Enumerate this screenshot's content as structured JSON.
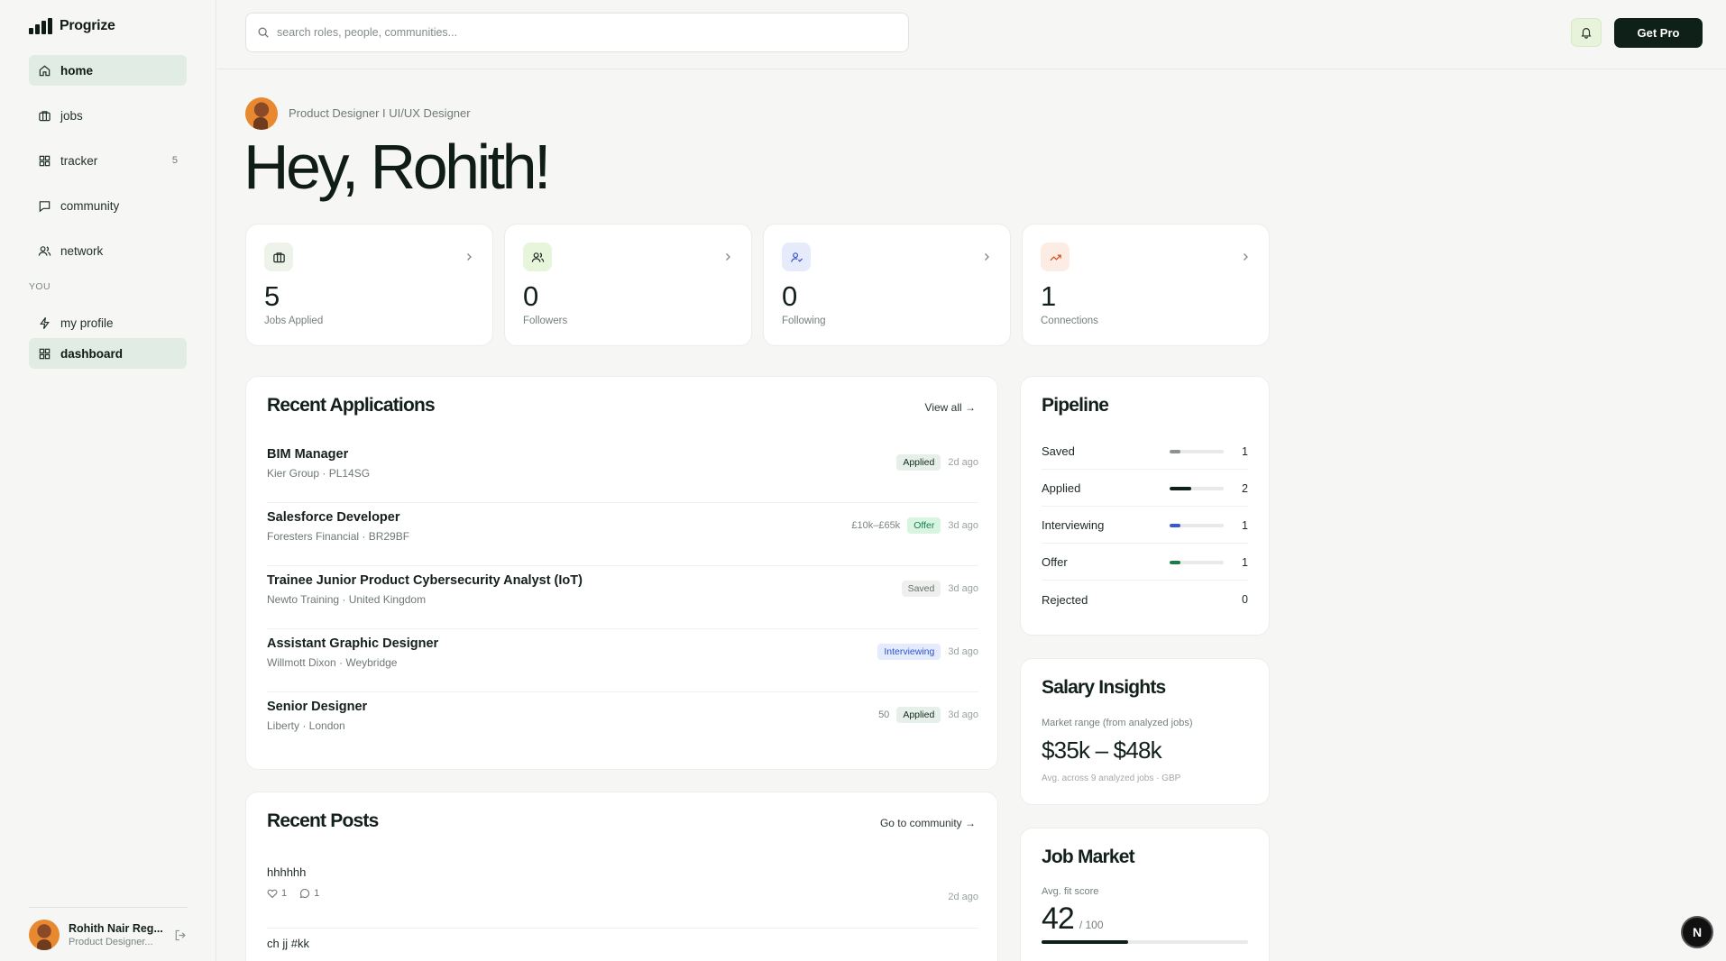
{
  "brand": {
    "name": "Progrize"
  },
  "sidebar": {
    "items": [
      {
        "label": "home",
        "icon": "home-icon",
        "active": true
      },
      {
        "label": "jobs",
        "icon": "briefcase-icon"
      },
      {
        "label": "tracker",
        "icon": "grid-icon",
        "count": "5"
      },
      {
        "label": "community",
        "icon": "chat-icon"
      },
      {
        "label": "network",
        "icon": "users-icon"
      }
    ],
    "section_label": "YOU",
    "you_items": [
      {
        "label": "my profile",
        "icon": "bolt-icon"
      },
      {
        "label": "dashboard",
        "icon": "grid-icon",
        "active": true
      }
    ],
    "user": {
      "name": "Rohith Nair Reg...",
      "role": "Product Designer..."
    }
  },
  "search": {
    "placeholder": "search roles, people, communities..."
  },
  "topbar": {
    "get_pro_label": "Get Pro"
  },
  "hero": {
    "subtitle": "Product Designer I UI/UX Designer",
    "greeting": "Hey, Rohith!"
  },
  "stats": [
    {
      "value": "5",
      "label": "Jobs Applied",
      "icon": "briefcase-icon",
      "color": "#eef3ea"
    },
    {
      "value": "0",
      "label": "Followers",
      "icon": "users-icon",
      "color": "#e7f5db"
    },
    {
      "value": "0",
      "label": "Following",
      "icon": "user-check-icon",
      "color": "#e6ebfb"
    },
    {
      "value": "1",
      "label": "Connections",
      "icon": "trending-up-icon",
      "color": "#fdece4"
    }
  ],
  "recent_applications": {
    "title": "Recent Applications",
    "link": "View all →",
    "rows": [
      {
        "title": "BIM Manager",
        "sub": "Kier Group · PL14SG",
        "meta": "",
        "status": "Applied",
        "age": "2d ago"
      },
      {
        "title": "Salesforce Developer",
        "sub": "Foresters Financial · BR29BF",
        "meta": "£10k–£65k",
        "status": "Offer",
        "age": "3d ago"
      },
      {
        "title": "Trainee Junior Product Cybersecurity Analyst (IoT)",
        "sub": "Newto Training · United Kingdom",
        "meta": "",
        "status": "Saved",
        "age": "3d ago"
      },
      {
        "title": "Assistant Graphic Designer",
        "sub": "Willmott Dixon · Weybridge",
        "meta": "",
        "status": "Interviewing",
        "age": "3d ago"
      },
      {
        "title": "Senior Designer",
        "sub": "Liberty · London",
        "meta": "50",
        "status": "Applied",
        "age": "3d ago"
      }
    ]
  },
  "pipeline": {
    "title": "Pipeline",
    "rows": [
      {
        "label": "Saved",
        "count": "1",
        "fraction": 0.2,
        "color": "#8c938f"
      },
      {
        "label": "Applied",
        "count": "2",
        "fraction": 0.4,
        "color": "#0f2018"
      },
      {
        "label": "Interviewing",
        "count": "1",
        "fraction": 0.2,
        "color": "#3b55d9"
      },
      {
        "label": "Offer",
        "count": "1",
        "fraction": 0.2,
        "color": "#1b7a4c"
      },
      {
        "label": "Rejected",
        "count": "0",
        "fraction": 0,
        "color": "#c44"
      }
    ]
  },
  "salary": {
    "title": "Salary Insights",
    "label": "Market range (from analyzed jobs)",
    "value": "$35k – $48k",
    "note": "Avg. across 9 analyzed jobs · GBP"
  },
  "job_market": {
    "title": "Job Market",
    "label": "Avg. fit score",
    "score": "42",
    "out_of": "/ 100",
    "fraction": 0.42
  },
  "recent_posts": {
    "title": "Recent Posts",
    "link": "Go to community →",
    "posts": [
      {
        "text": "hhhhhh",
        "likes": "1",
        "comments": "1",
        "age": "2d ago"
      },
      {
        "text": "ch jj #kk"
      }
    ]
  },
  "fab_label": "N"
}
